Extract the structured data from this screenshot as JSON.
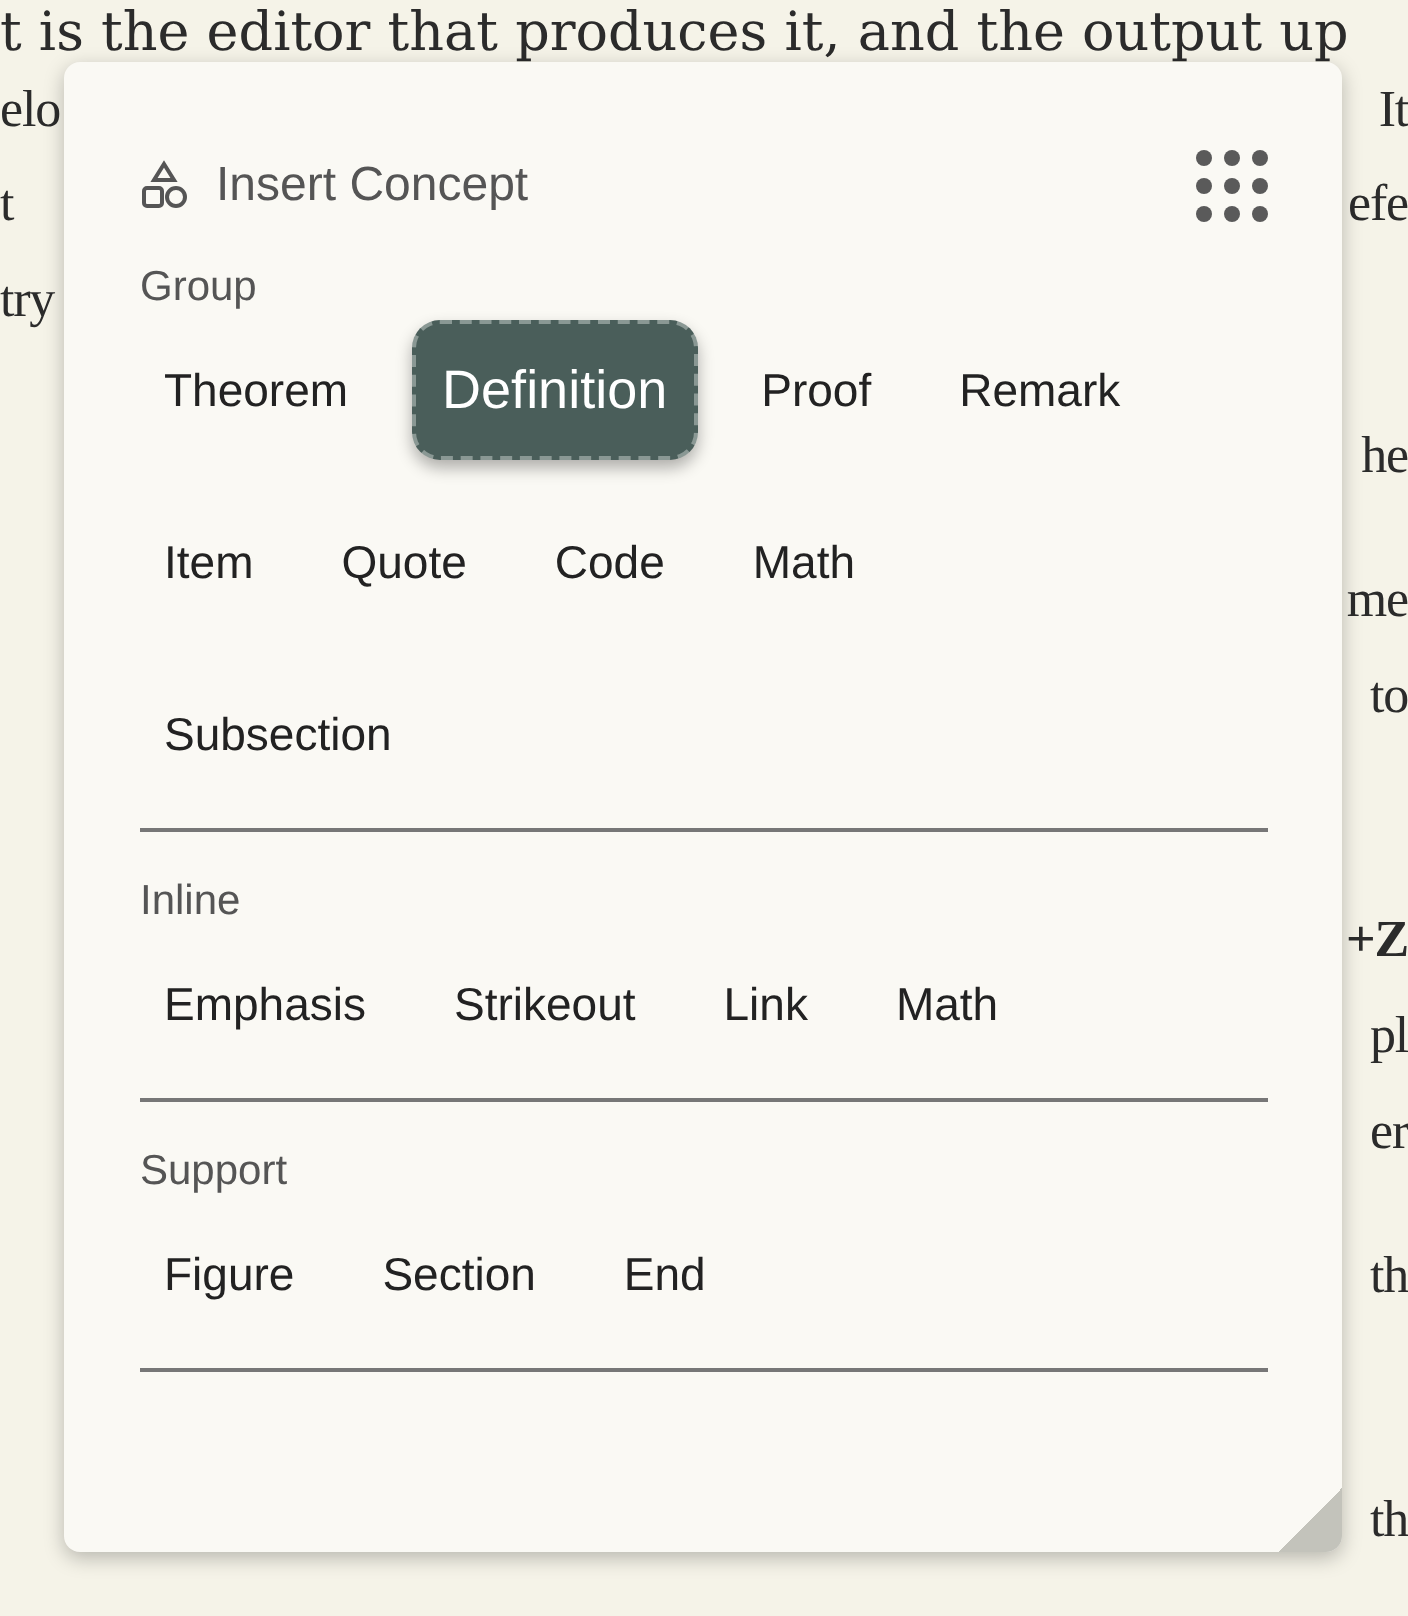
{
  "background_text": {
    "paragraphs": [
      {
        "lines": [
          {
            "left": {
              "text": "t is the editor that produces it, and the output up",
              "bold": false
            }
          },
          {
            "left": {
              "text": "elo",
              "bold": false
            },
            "right": {
              "text": "It",
              "bold": false
            }
          },
          {
            "left": {
              "text": "t",
              "bold": false
            },
            "right": {
              "text": "efe",
              "bold": false
            }
          },
          {
            "left": {
              "text": "try",
              "bold": false
            }
          }
        ]
      },
      {
        "lines": [
          {
            "right": {
              "text": "he",
              "bold": false
            }
          }
        ]
      },
      {
        "lines": [
          {
            "right": {
              "text": "me",
              "bold": false
            }
          },
          {
            "right": {
              "text": "to",
              "bold": false
            }
          }
        ]
      },
      {
        "lines": [
          {
            "right": {
              "text": "+Z",
              "bold": true
            }
          },
          {
            "right": {
              "text": "pl",
              "bold": false
            }
          },
          {
            "right": {
              "text": "er",
              "bold": false
            }
          }
        ]
      },
      {
        "lines": [
          {
            "right": {
              "text": "th",
              "bold": false
            }
          }
        ]
      },
      {
        "lines": [
          {
            "right": {
              "text": "th",
              "bold": false
            }
          }
        ]
      }
    ]
  },
  "panel": {
    "title": "Insert Concept",
    "sections": [
      {
        "label": "Group",
        "items": [
          {
            "label": "Theorem",
            "selected": false
          },
          {
            "label": "Definition",
            "selected": true
          },
          {
            "label": "Proof",
            "selected": false
          },
          {
            "label": "Remark",
            "selected": false
          },
          {
            "label": "Item",
            "selected": false
          },
          {
            "label": "Quote",
            "selected": false
          },
          {
            "label": "Code",
            "selected": false
          },
          {
            "label": "Math",
            "selected": false
          },
          {
            "label": "Subsection",
            "selected": false
          }
        ]
      },
      {
        "label": "Inline",
        "items": [
          {
            "label": "Emphasis",
            "selected": false
          },
          {
            "label": "Strikeout",
            "selected": false
          },
          {
            "label": "Link",
            "selected": false
          },
          {
            "label": "Math",
            "selected": false
          }
        ]
      },
      {
        "label": "Support",
        "items": [
          {
            "label": "Figure",
            "selected": false
          },
          {
            "label": "Section",
            "selected": false
          },
          {
            "label": "End",
            "selected": false
          }
        ]
      }
    ]
  }
}
